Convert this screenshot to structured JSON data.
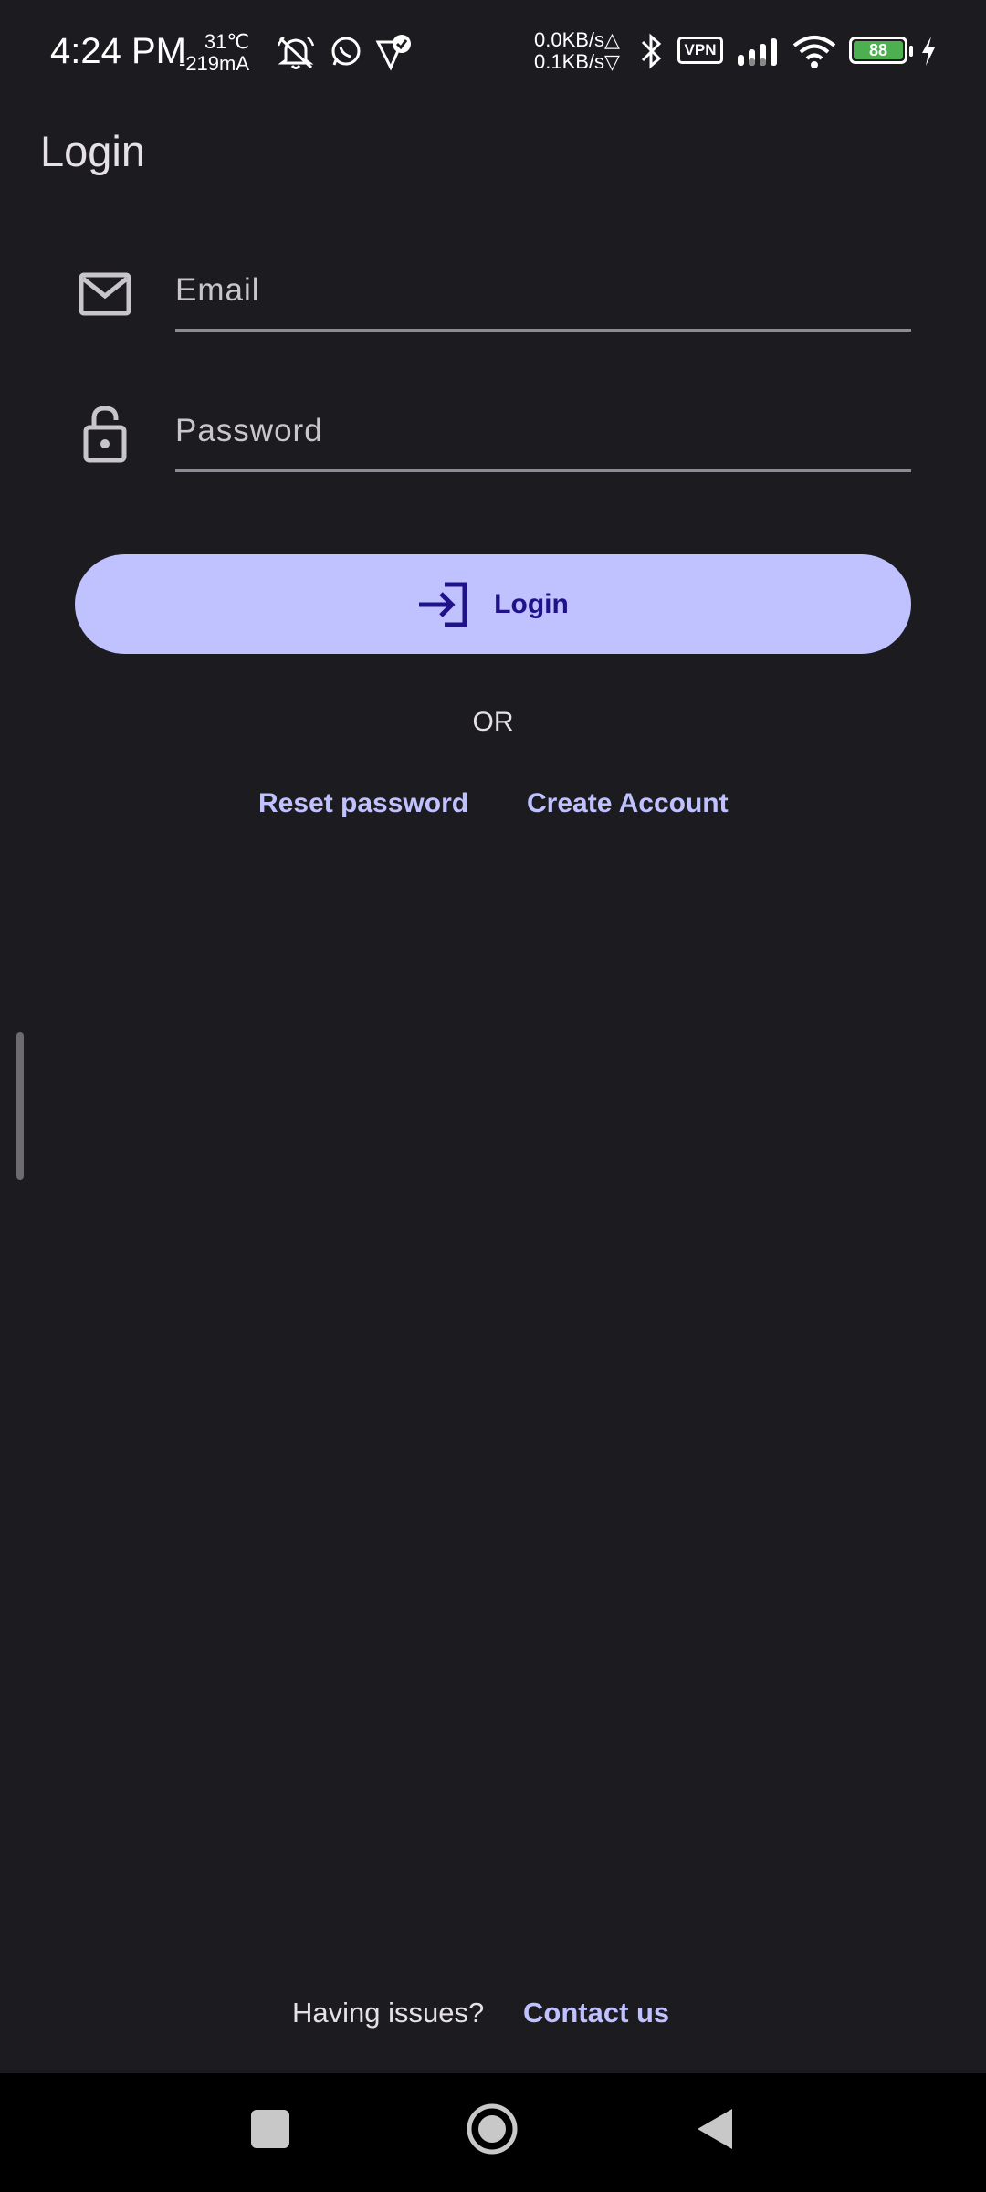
{
  "status_bar": {
    "time": "4:24 PM",
    "temperature": "31℃",
    "current": "-219mA",
    "upload_speed": "0.0KB/s",
    "upload_arrow": "△",
    "download_speed": "0.1KB/s",
    "download_arrow": "▽",
    "vpn_label": "VPN",
    "battery_level": "88",
    "battery_color": "#4caf50"
  },
  "app_bar": {
    "title": "Login"
  },
  "form": {
    "email_placeholder": "Email",
    "email_value": "",
    "password_placeholder": "Password",
    "password_value": "",
    "login_label": "Login"
  },
  "or_label": "OR",
  "links": {
    "reset_password": "Reset password",
    "create_account": "Create Account"
  },
  "footer": {
    "question": "Having issues?",
    "contact_label": "Contact us"
  },
  "colors": {
    "background": "#1c1b20",
    "accent": "#c0c1ff",
    "accent_on": "#20138a"
  },
  "icons": {
    "email": "envelope-icon",
    "password": "lock-icon",
    "login": "login-arrow-icon"
  }
}
